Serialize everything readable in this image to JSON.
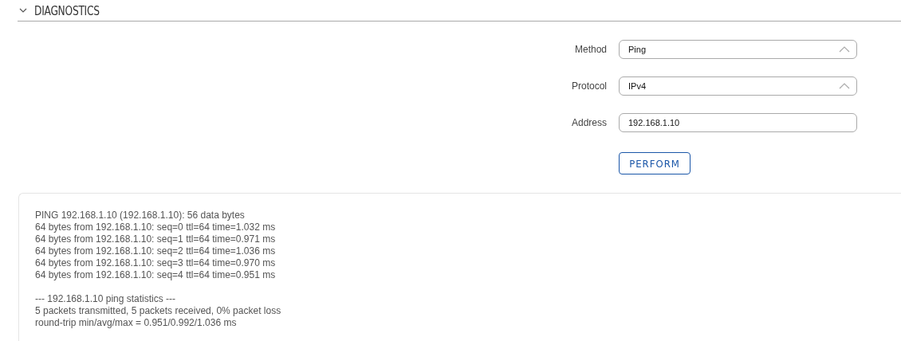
{
  "section": {
    "title": "DIAGNOSTICS",
    "expanded": true
  },
  "fields": [
    {
      "kind": "select",
      "label": "Method",
      "value": "Ping"
    },
    {
      "kind": "select",
      "label": "Protocol",
      "value": "IPv4"
    },
    {
      "kind": "input",
      "label": "Address",
      "value": "192.168.1.10"
    }
  ],
  "perform_button": "PERFORM",
  "output": {
    "blocks": [
      [
        "PING 192.168.1.10 (192.168.1.10): 56 data bytes",
        "64 bytes from 192.168.1.10: seq=0 ttl=64 time=1.032 ms",
        "64 bytes from 192.168.1.10: seq=1 ttl=64 time=0.971 ms",
        "64 bytes from 192.168.1.10: seq=2 ttl=64 time=1.036 ms",
        "64 bytes from 192.168.1.10: seq=3 ttl=64 time=0.970 ms",
        "64 bytes from 192.168.1.10: seq=4 ttl=64 time=0.951 ms"
      ],
      [
        "--- 192.168.1.10 ping statistics ---",
        "5 packets transmitted, 5 packets received, 0% packet loss",
        "round-trip min/avg/max = 0.951/0.992/1.036 ms"
      ]
    ]
  }
}
